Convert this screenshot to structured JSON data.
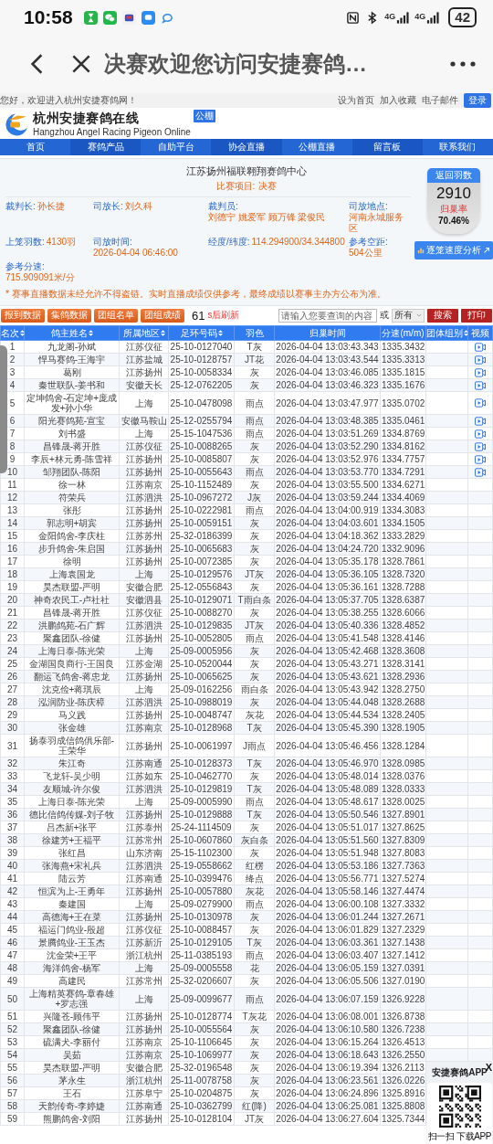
{
  "status_bar": {
    "time": "10:58",
    "battery": "42",
    "network": [
      "4G",
      "4G"
    ]
  },
  "browser": {
    "title": "决赛欢迎您访问安捷赛鸽…"
  },
  "site_top": {
    "greeting": "您好，欢迎进入杭州安捷赛鸽网！",
    "links": [
      "设为首页",
      "加入收藏",
      "电子邮件"
    ],
    "login": "登录"
  },
  "logo": {
    "name": "杭州安捷赛鸽在线",
    "english": "Hangzhou Angel Racing Pigeon Online",
    "badge": "公棚"
  },
  "nav": [
    "首页",
    "赛鸽产品",
    "自助平台",
    "协会直播",
    "公棚直播",
    "留言板",
    "联系我们"
  ],
  "race": {
    "title": "江苏扬州福联翱翔赛鸽中心",
    "event_label": "比赛项目:",
    "event": "决赛",
    "info": [
      {
        "label": "裁判长:",
        "value": "孙长捷"
      },
      {
        "label": "司放长:",
        "value": "刘久科"
      },
      {
        "label": "裁判员:",
        "value": "刘德宁 姚爱军 顾万锋 梁俊民"
      },
      {
        "label": "司放地点:",
        "value": "河南永城服务区"
      },
      {
        "label": "上笼羽数:",
        "value": "4130羽"
      },
      {
        "label": "司放时间:",
        "value": "2026-04-04 06:46:00"
      },
      {
        "label": "经度/纬度:",
        "value": "114.294900/34.344800"
      },
      {
        "label": "参考空距:",
        "value": "504公里"
      },
      {
        "label": "参考分速:",
        "value": "715.909091米/分"
      }
    ],
    "notice": "* 赛事直播数据未经允许不得盗链。实时直播成绩仅供参考，最终成绩以赛事主办方公布为准。",
    "returned": {
      "label": "返回羽数",
      "count": "2910",
      "rate_label": "归巢率",
      "rate": "70.46%"
    },
    "analysis_button": "逐笼速度分析"
  },
  "toolbar": {
    "buttons": [
      "报到数据",
      "集鸽数据",
      "团组名单",
      "团组成绩"
    ],
    "countdown": "61",
    "countdown_label": "s后刷新",
    "search": {
      "placeholder": "请输入您要查询的内容"
    },
    "or": "或",
    "filter": "所有",
    "search_button": "搜索",
    "print_button": "打印"
  },
  "table": {
    "columns": [
      {
        "label": "名次",
        "sortable": true
      },
      {
        "label": "鸽主姓名",
        "sortable": true
      },
      {
        "label": "所属地区",
        "sortable": true
      },
      {
        "label": "足环号码",
        "sortable": true
      },
      {
        "label": "羽色",
        "sortable": false
      },
      {
        "label": "归巢时间",
        "sortable": false
      },
      {
        "label": "分速(m/m)",
        "sortable": false
      },
      {
        "label": "团体组别",
        "sortable": true
      },
      {
        "label": "视频",
        "sortable": false
      }
    ],
    "rows": [
      {
        "rank": "1",
        "name": "九龙阁-孙斌",
        "region": "江苏仪征",
        "ring": "25-10-0127040",
        "plumage": "T灰",
        "time": "2026-04-04 13:03:43.343",
        "speed": "1335.3432",
        "video": true
      },
      {
        "rank": "2",
        "name": "悍马赛鸽-王海宇",
        "region": "江苏盐城",
        "ring": "25-10-0128757",
        "plumage": "JT花",
        "time": "2026-04-04 13:03:43.544",
        "speed": "1335.3313",
        "video": true
      },
      {
        "rank": "3",
        "name": "葛刚",
        "region": "江苏扬州",
        "ring": "25-10-0058334",
        "plumage": "灰",
        "time": "2026-04-04 13:03:46.085",
        "speed": "1335.1815",
        "video": true
      },
      {
        "rank": "4",
        "name": "秦世联队-姜书和",
        "region": "安徽天长",
        "ring": "25-12-0762205",
        "plumage": "灰",
        "time": "2026-04-04 13:03:46.323",
        "speed": "1335.1676",
        "video": true
      },
      {
        "rank": "5",
        "name": "定坤鸽舍-石定坤+庞成发+孙小华",
        "region": "上海",
        "ring": "25-10-0478098",
        "plumage": "雨点",
        "time": "2026-04-04 13:03:47.977",
        "speed": "1335.0702",
        "video": true
      },
      {
        "rank": "6",
        "name": "阳光赛鸽苑-宣宝",
        "region": "安徽马鞍山",
        "ring": "25-12-0255794",
        "plumage": "雨点",
        "time": "2026-04-04 13:03:48.385",
        "speed": "1335.0461",
        "video": true
      },
      {
        "rank": "7",
        "name": "刘书盛",
        "region": "上海",
        "ring": "25-15-1047536",
        "plumage": "雨点",
        "time": "2026-04-04 13:03:51.269",
        "speed": "1334.8769",
        "video": true
      },
      {
        "rank": "8",
        "name": "昌锋晟-蒋开胜",
        "region": "江苏仪征",
        "ring": "25-10-0088265",
        "plumage": "灰",
        "time": "2026-04-04 13:03:52.290",
        "speed": "1334.8162",
        "video": true
      },
      {
        "rank": "9",
        "name": "李辰+林元勇-陈雪祥",
        "region": "江苏扬州",
        "ring": "25-10-0085807",
        "plumage": "灰",
        "time": "2026-04-04 13:03:52.976",
        "speed": "1334.7757",
        "video": true
      },
      {
        "rank": "10",
        "name": "邹翔团队-陈阳",
        "region": "江苏扬州",
        "ring": "25-10-0055643",
        "plumage": "雨点",
        "time": "2026-04-04 13:03:53.770",
        "speed": "1334.7291",
        "video": true
      },
      {
        "rank": "11",
        "name": "徐一林",
        "region": "江苏南京",
        "ring": "25-10-1152489",
        "plumage": "灰",
        "time": "2026-04-04 13:03:55.500",
        "speed": "1334.6271",
        "video": false
      },
      {
        "rank": "12",
        "name": "符荣兵",
        "region": "江苏泗洪",
        "ring": "25-10-0967272",
        "plumage": "J灰",
        "time": "2026-04-04 13:03:59.244",
        "speed": "1334.4069",
        "video": false
      },
      {
        "rank": "13",
        "name": "张彤",
        "region": "江苏扬州",
        "ring": "25-10-0222981",
        "plumage": "雨点",
        "time": "2026-04-04 13:04:00.919",
        "speed": "1334.3083",
        "video": false
      },
      {
        "rank": "14",
        "name": "郭志明+胡宾",
        "region": "江苏扬州",
        "ring": "25-10-0059151",
        "plumage": "灰",
        "time": "2026-04-04 13:04:03.601",
        "speed": "1334.1505",
        "video": false
      },
      {
        "rank": "15",
        "name": "金阳鸽舍-李庆柱",
        "region": "江苏苏州",
        "ring": "25-32-0186399",
        "plumage": "灰",
        "time": "2026-04-04 13:04:18.362",
        "speed": "1333.2829",
        "video": false
      },
      {
        "rank": "16",
        "name": "步升鸽舍-朱启国",
        "region": "江苏扬州",
        "ring": "25-10-0065683",
        "plumage": "灰",
        "time": "2026-04-04 13:04:24.720",
        "speed": "1332.9096",
        "video": false
      },
      {
        "rank": "17",
        "name": "徐明",
        "region": "江苏扬州",
        "ring": "25-10-0072385",
        "plumage": "灰",
        "time": "2026-04-04 13:05:35.178",
        "speed": "1328.7861",
        "video": false
      },
      {
        "rank": "18",
        "name": "上海袁国龙",
        "region": "上海",
        "ring": "25-10-0129576",
        "plumage": "JT灰",
        "time": "2026-04-04 13:05:36.105",
        "speed": "1328.7320",
        "video": false
      },
      {
        "rank": "19",
        "name": "昊杰联盟-严明",
        "region": "安徽合肥",
        "ring": "25-12-0556843",
        "plumage": "灰",
        "time": "2026-04-04 13:05:36.161",
        "speed": "1328.7288",
        "video": false
      },
      {
        "rank": "20",
        "name": "神奇农民工-卢社社",
        "region": "安徽泗县",
        "ring": "25-10-0129071",
        "plumage": "T雨白条",
        "time": "2026-04-04 13:05:37.705",
        "speed": "1328.6387",
        "video": false
      },
      {
        "rank": "21",
        "name": "昌锋晟-蒋开胜",
        "region": "江苏仪征",
        "ring": "25-10-0088270",
        "plumage": "灰",
        "time": "2026-04-04 13:05:38.255",
        "speed": "1328.6066",
        "video": false
      },
      {
        "rank": "22",
        "name": "洪鹏鸽苑-石广辉",
        "region": "江苏泗洪",
        "ring": "25-10-0129835",
        "plumage": "JT灰",
        "time": "2026-04-04 13:05:40.336",
        "speed": "1328.4852",
        "video": false
      },
      {
        "rank": "23",
        "name": "聚鑫团队-徐健",
        "region": "江苏扬州",
        "ring": "25-10-0052805",
        "plumage": "雨点",
        "time": "2026-04-04 13:05:41.548",
        "speed": "1328.4146",
        "video": false
      },
      {
        "rank": "24",
        "name": "上海日泰-陈光荣",
        "region": "上海",
        "ring": "25-09-0005956",
        "plumage": "灰",
        "time": "2026-04-04 13:05:42.468",
        "speed": "1328.3608",
        "video": false
      },
      {
        "rank": "25",
        "name": "金湖国良商行-王国良",
        "region": "江苏金湖",
        "ring": "25-10-0520044",
        "plumage": "灰",
        "time": "2026-04-04 13:05:43.271",
        "speed": "1328.3141",
        "video": false
      },
      {
        "rank": "26",
        "name": "翻运飞鸽舍-蒋忠龙",
        "region": "江苏扬州",
        "ring": "25-10-0065625",
        "plumage": "灰",
        "time": "2026-04-04 13:05:43.621",
        "speed": "1328.2936",
        "video": false
      },
      {
        "rank": "27",
        "name": "沈克俭+蒋琪辰",
        "region": "上海",
        "ring": "25-09-0162256",
        "plumage": "雨白条",
        "time": "2026-04-04 13:05:43.942",
        "speed": "1328.2750",
        "video": false
      },
      {
        "rank": "28",
        "name": "泓润防业-陈庆樟",
        "region": "江苏泗洪",
        "ring": "25-10-0988019",
        "plumage": "灰",
        "time": "2026-04-04 13:05:44.048",
        "speed": "1328.2688",
        "video": false
      },
      {
        "rank": "29",
        "name": "马义践",
        "region": "江苏扬州",
        "ring": "25-10-0048747",
        "plumage": "灰花",
        "time": "2026-04-04 13:05:44.534",
        "speed": "1328.2405",
        "video": false
      },
      {
        "rank": "30",
        "name": "张金雄",
        "region": "江苏南京",
        "ring": "25-10-0128968",
        "plumage": "T灰",
        "time": "2026-04-04 13:05:45.390",
        "speed": "1328.1905",
        "video": false
      },
      {
        "rank": "31",
        "name": "扬泰羽成信鸽俱乐部-王荣华",
        "region": "江苏扬州",
        "ring": "25-10-0061997",
        "plumage": "J雨点",
        "time": "2026-04-04 13:05:46.456",
        "speed": "1328.1284",
        "video": false
      },
      {
        "rank": "32",
        "name": "朱江奇",
        "region": "江苏南通",
        "ring": "25-10-0128373",
        "plumage": "T灰",
        "time": "2026-04-04 13:05:46.970",
        "speed": "1328.0985",
        "video": false
      },
      {
        "rank": "33",
        "name": "飞龙轩-吴少明",
        "region": "江苏如东",
        "ring": "25-10-0462770",
        "plumage": "灰",
        "time": "2026-04-04 13:05:48.014",
        "speed": "1328.0376",
        "video": false
      },
      {
        "rank": "34",
        "name": "友顺城-许尔俊",
        "region": "江苏泗洪",
        "ring": "25-10-0129819",
        "plumage": "T灰",
        "time": "2026-04-04 13:05:48.089",
        "speed": "1328.0333",
        "video": false
      },
      {
        "rank": "35",
        "name": "上海日泰-陈光荣",
        "region": "上海",
        "ring": "25-09-0005990",
        "plumage": "雨点",
        "time": "2026-04-04 13:05:48.617",
        "speed": "1328.0025",
        "video": false
      },
      {
        "rank": "36",
        "name": "德比信鸽传媒-刘子牧",
        "region": "江苏扬州",
        "ring": "25-10-0129888",
        "plumage": "T灰",
        "time": "2026-04-04 13:05:50.546",
        "speed": "1327.8901",
        "video": false
      },
      {
        "rank": "37",
        "name": "吕杰新+张平",
        "region": "江苏泰州",
        "ring": "25-24-1114509",
        "plumage": "灰",
        "time": "2026-04-04 13:05:51.017",
        "speed": "1327.8625",
        "video": false
      },
      {
        "rank": "38",
        "name": "徐建芳+王福平",
        "region": "江苏常州",
        "ring": "25-10-0607860",
        "plumage": "灰白条",
        "time": "2026-04-04 13:05:51.560",
        "speed": "1327.8309",
        "video": false
      },
      {
        "rank": "39",
        "name": "张红昌",
        "region": "山东济南",
        "ring": "25-15-1102300",
        "plumage": "灰",
        "time": "2026-04-04 13:05:51.948",
        "speed": "1327.8083",
        "video": false
      },
      {
        "rank": "40",
        "name": "张海燕+宋礼兵",
        "region": "江苏泗洪",
        "ring": "25-19-0558662",
        "plumage": "红楞",
        "time": "2026-04-04 13:05:53.186",
        "speed": "1327.7363",
        "video": false
      },
      {
        "rank": "41",
        "name": "陆云芳",
        "region": "江苏南通",
        "ring": "25-10-0399476",
        "plumage": "绛点",
        "time": "2026-04-04 13:05:56.771",
        "speed": "1327.5274",
        "video": false
      },
      {
        "rank": "42",
        "name": "恒滨为上-王勇年",
        "region": "江苏扬州",
        "ring": "25-10-0057880",
        "plumage": "灰花",
        "time": "2026-04-04 13:05:58.146",
        "speed": "1327.4474",
        "video": false
      },
      {
        "rank": "43",
        "name": "秦建国",
        "region": "上海",
        "ring": "25-09-0279900",
        "plumage": "雨点",
        "time": "2026-04-04 13:06:00.108",
        "speed": "1327.3332",
        "video": false
      },
      {
        "rank": "44",
        "name": "高德海+王在菜",
        "region": "江苏扬州",
        "ring": "25-10-0130978",
        "plumage": "灰",
        "time": "2026-04-04 13:06:01.244",
        "speed": "1327.2671",
        "video": false
      },
      {
        "rank": "45",
        "name": "福运门鸽业-殷超",
        "region": "江苏仪征",
        "ring": "25-10-0088457",
        "plumage": "灰",
        "time": "2026-04-04 13:06:01.829",
        "speed": "1327.2329",
        "video": false
      },
      {
        "rank": "46",
        "name": "景腾鸽业-王玉杰",
        "region": "江苏新沂",
        "ring": "25-10-0129105",
        "plumage": "T灰",
        "time": "2026-04-04 13:06:03.361",
        "speed": "1327.1438",
        "video": false
      },
      {
        "rank": "47",
        "name": "沈金荣+王平",
        "region": "浙江杭州",
        "ring": "25-11-0385193",
        "plumage": "雨点",
        "time": "2026-04-04 13:06:03.407",
        "speed": "1327.1412",
        "video": false
      },
      {
        "rank": "48",
        "name": "海洋鸽舍-杨军",
        "region": "上海",
        "ring": "25-09-0005558",
        "plumage": "花",
        "time": "2026-04-04 13:06:05.159",
        "speed": "1327.0391",
        "video": false
      },
      {
        "rank": "49",
        "name": "高建民",
        "region": "江苏常州",
        "ring": "25-32-0206607",
        "plumage": "灰",
        "time": "2026-04-04 13:06:05.506",
        "speed": "1327.0190",
        "video": false
      },
      {
        "rank": "50",
        "name": "上海精英赛鸽-章春雄+罗志强",
        "region": "上海",
        "ring": "25-09-0099677",
        "plumage": "雨点",
        "time": "2026-04-04 13:06:07.159",
        "speed": "1326.9228",
        "video": false
      },
      {
        "rank": "51",
        "name": "兴隆苍-顾伟平",
        "region": "江苏扬州",
        "ring": "25-10-0128774",
        "plumage": "T灰花",
        "time": "2026-04-04 13:06:08.001",
        "speed": "1326.8738",
        "video": false
      },
      {
        "rank": "52",
        "name": "聚鑫团队-徐健",
        "region": "江苏扬州",
        "ring": "25-10-0055564",
        "plumage": "灰",
        "time": "2026-04-04 13:06:10.580",
        "speed": "1326.7238",
        "video": false
      },
      {
        "rank": "53",
        "name": "硫满犬-李丽付",
        "region": "江苏南京",
        "ring": "25-10-1106645",
        "plumage": "灰",
        "time": "2026-04-04 13:06:15.264",
        "speed": "1326.4513"
      },
      {
        "rank": "54",
        "name": "吴茹",
        "region": "江苏南京",
        "ring": "25-10-1069977",
        "plumage": "灰",
        "time": "2026-04-04 13:06:18.643",
        "speed": "1326.2550"
      },
      {
        "rank": "55",
        "name": "昊杰联盟-严明",
        "region": "安徽合肥",
        "ring": "25-32-0196548",
        "plumage": "灰",
        "time": "2026-04-04 13:06:19.394",
        "speed": "1326.2113"
      },
      {
        "rank": "56",
        "name": "茅永生",
        "region": "浙江杭州",
        "ring": "25-11-0078758",
        "plumage": "灰",
        "time": "2026-04-04 13:06:23.561",
        "speed": "1326.0226"
      },
      {
        "rank": "57",
        "name": "王石",
        "region": "江苏阜宁",
        "ring": "25-10-0204875",
        "plumage": "灰",
        "time": "2026-04-04 13:06:24.896",
        "speed": "1325.8916"
      },
      {
        "rank": "58",
        "name": "天韵传奇-李婷婕",
        "region": "江苏南通",
        "ring": "25-10-0362799",
        "plumage": "红(降)",
        "time": "2026-04-04 13:06:25.081",
        "speed": "1325.8808"
      },
      {
        "rank": "59",
        "name": "熊鹏鸽舍-刘阳",
        "region": "江苏扬州",
        "ring": "25-10-0128104",
        "plumage": "JT灰",
        "time": "2026-04-04 13:06:27.604",
        "speed": "1325.7344"
      }
    ]
  },
  "app_popup": {
    "title": "安捷赛鸽APP",
    "caption": "扫一扫 下载APP",
    "close": "X"
  }
}
